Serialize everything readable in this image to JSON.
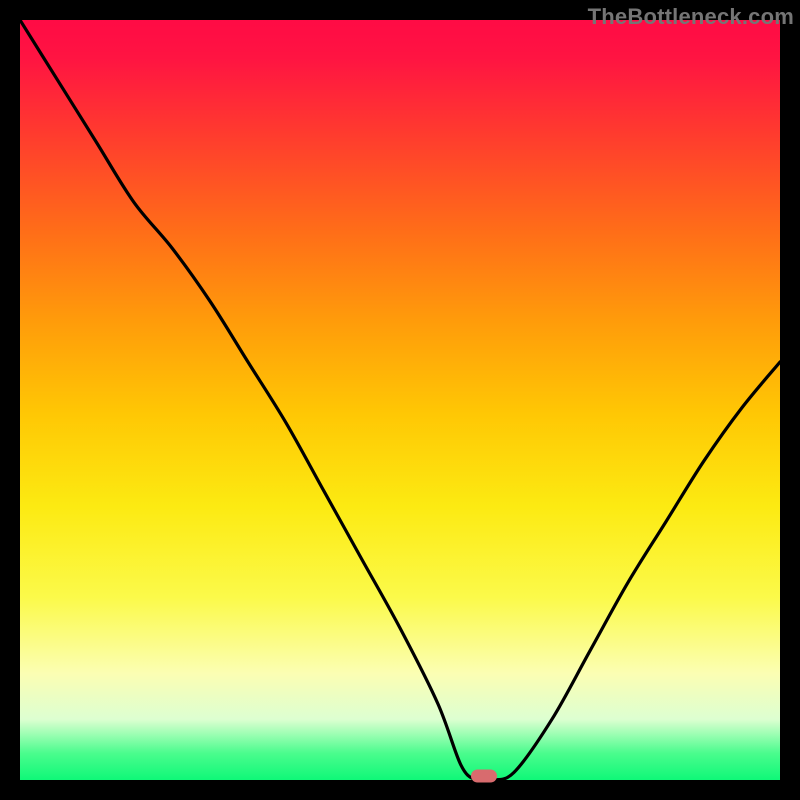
{
  "watermark": "TheBottleneck.com",
  "chart_data": {
    "type": "line",
    "title": "",
    "xlabel": "",
    "ylabel": "",
    "xlim": [
      0,
      100
    ],
    "ylim": [
      0,
      100
    ],
    "x": [
      0,
      5,
      10,
      15,
      20,
      25,
      30,
      35,
      40,
      45,
      50,
      55,
      58,
      60,
      62,
      65,
      70,
      75,
      80,
      85,
      90,
      95,
      100
    ],
    "values": [
      100,
      92,
      84,
      76,
      70,
      63,
      55,
      47,
      38,
      29,
      20,
      10,
      2,
      0,
      0,
      1,
      8,
      17,
      26,
      34,
      42,
      49,
      55
    ],
    "marker": {
      "x": 61,
      "y": 0
    },
    "background_gradient": {
      "top": "#ff0b45",
      "bottom": "#0ff878"
    }
  }
}
